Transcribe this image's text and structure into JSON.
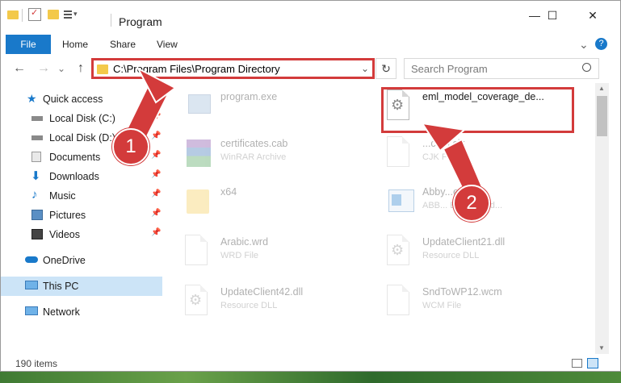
{
  "window": {
    "title": "Program",
    "controls": {
      "minimize": "—",
      "maximize": "☐",
      "close": "✕"
    }
  },
  "ribbon": {
    "tabs": [
      "File",
      "Home",
      "Share",
      "View"
    ],
    "help": "?",
    "expand": "⌄"
  },
  "navigation": {
    "back": "←",
    "forward": "→",
    "recent": "⌄",
    "up": "↑",
    "address": "C:\\Program Files\\Program Directory",
    "address_dropdown": "⌄",
    "refresh": "↻",
    "search_placeholder": "Search Program"
  },
  "sidebar": {
    "items": [
      {
        "label": "Quick access",
        "icon": "star-icon",
        "pinned": false
      },
      {
        "label": "Local Disk (C:)",
        "icon": "drive-icon",
        "pinned": true
      },
      {
        "label": "Local Disk (D:)",
        "icon": "drive-icon",
        "pinned": true
      },
      {
        "label": "Documents",
        "icon": "documents-icon",
        "pinned": true
      },
      {
        "label": "Downloads",
        "icon": "downloads-icon",
        "pinned": true
      },
      {
        "label": "Music",
        "icon": "music-icon",
        "pinned": true
      },
      {
        "label": "Pictures",
        "icon": "pictures-icon",
        "pinned": true
      },
      {
        "label": "Videos",
        "icon": "videos-icon",
        "pinned": true
      },
      {
        "label": "OneDrive",
        "icon": "cloud-icon",
        "pinned": false
      },
      {
        "label": "This PC",
        "icon": "computer-icon",
        "pinned": false,
        "selected": true
      },
      {
        "label": "Network",
        "icon": "network-icon",
        "pinned": false
      }
    ]
  },
  "files": [
    {
      "name": "program.exe",
      "type": "",
      "icon": "exe-icon",
      "faded": true
    },
    {
      "name": "eml_model_coverage_de...",
      "type": "",
      "icon": "dll-gear-icon",
      "faded": false,
      "highlighted": true
    },
    {
      "name": "certificates.cab",
      "type": "WinRAR Archive",
      "icon": "archive-icon",
      "faded": true
    },
    {
      "name": "...cem.cjk",
      "type": "CJK File",
      "icon": "file-icon",
      "faded": true
    },
    {
      "name": "x64",
      "type": "",
      "icon": "folder-icon",
      "faded": true
    },
    {
      "name": "Abby...exe",
      "type": "ABB... Event hand...",
      "icon": "app-icon",
      "faded": true
    },
    {
      "name": "Arabic.wrd",
      "type": "WRD File",
      "icon": "file-icon",
      "faded": true
    },
    {
      "name": "UpdateClient21.dll",
      "type": "Resource DLL",
      "icon": "dll-gear-icon",
      "faded": true
    },
    {
      "name": "UpdateClient42.dll",
      "type": "Resource DLL",
      "icon": "dll-gear-icon",
      "faded": true
    },
    {
      "name": "SndToWP12.wcm",
      "type": "WCM File",
      "icon": "file-icon",
      "faded": true
    }
  ],
  "status": {
    "count": "190 items"
  },
  "callouts": [
    "1",
    "2"
  ],
  "colors": {
    "accent": "#1979ca",
    "highlight": "#d33b3b",
    "selection": "#cce4f7"
  }
}
